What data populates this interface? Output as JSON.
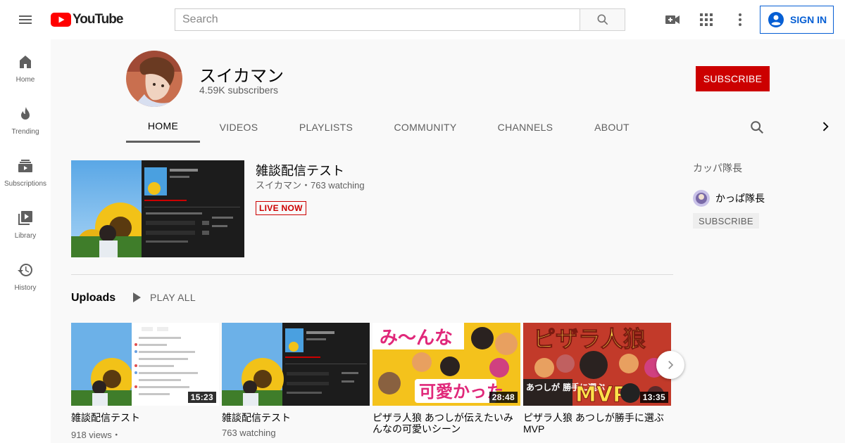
{
  "header": {
    "logo_text": "YouTube",
    "search_placeholder": "Search",
    "signin_label": "SIGN IN"
  },
  "sidebar": {
    "items": [
      {
        "label": "Home",
        "icon": "home-icon"
      },
      {
        "label": "Trending",
        "icon": "fire-icon"
      },
      {
        "label": "Subscriptions",
        "icon": "subscriptions-icon"
      },
      {
        "label": "Library",
        "icon": "library-icon"
      },
      {
        "label": "History",
        "icon": "history-icon"
      }
    ]
  },
  "channel": {
    "name": "スイカマン",
    "subscribers": "4.59K subscribers",
    "subscribe_label": "SUBSCRIBE",
    "tabs": [
      "HOME",
      "VIDEOS",
      "PLAYLISTS",
      "COMMUNITY",
      "CHANNELS",
      "ABOUT"
    ]
  },
  "featured": {
    "title": "雑談配信テスト",
    "meta": "スイカマン・763 watching",
    "badge": "LIVE NOW"
  },
  "uploads": {
    "title": "Uploads",
    "play_all": "PLAY ALL",
    "videos": [
      {
        "title": "雑談配信テスト",
        "meta": "918 views・",
        "duration": "15:23"
      },
      {
        "title": "雑談配信テスト",
        "meta": "763 watching",
        "duration": ""
      },
      {
        "title": "ピザラ人狼 あつしが伝えたいみんなの可愛いシーン",
        "meta": "",
        "duration": "28:48",
        "thumb_text_top": "み〜んな",
        "thumb_text_bottom": "可愛かった"
      },
      {
        "title": "ピザラ人狼 あつしが勝手に選ぶMVP",
        "meta": "",
        "duration": "13:35",
        "thumb_text_top": "ピザラ人狼",
        "thumb_text_bottom": "MVP",
        "thumb_text_side": "あつしが 勝手に選ぶ"
      }
    ]
  },
  "featured_channels": {
    "heading": "カッパ隊長",
    "channel_name": "かっぱ隊長",
    "subscribe_label": "SUBSCRIBE"
  },
  "colors": {
    "brand_red": "#cc0000",
    "link_blue": "#065fd4"
  }
}
